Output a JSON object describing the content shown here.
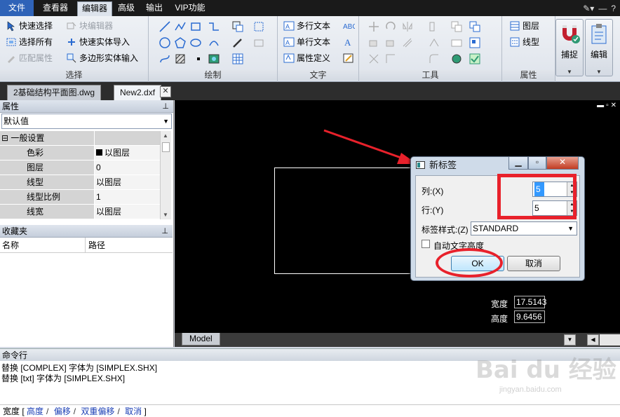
{
  "menu": {
    "tabs": [
      "文件",
      "查看器",
      "编辑器",
      "高级",
      "输出",
      "VIP功能"
    ],
    "active_tab": "编辑器"
  },
  "ribbon": {
    "select_group": {
      "label": "选择",
      "buttons": [
        "快速选择",
        "选择所有",
        "匹配属性",
        "块编辑器",
        "快速实体导入",
        "多边形实体输入"
      ]
    },
    "draw_group": {
      "label": "绘制"
    },
    "text_group": {
      "label": "文字",
      "buttons": [
        "多行文本",
        "单行文本",
        "属性定义"
      ]
    },
    "tools_group": {
      "label": "工具"
    },
    "props_group": {
      "label": "属性",
      "buttons": [
        "图层",
        "线型"
      ]
    },
    "snap_label": "捕捉",
    "edit_label": "编辑"
  },
  "doc_tabs": [
    "2基础结构平面图.dwg",
    "New2.dxf"
  ],
  "properties_panel": {
    "title": "属性",
    "dropdown": "默认值",
    "section": "一般设置",
    "rows": [
      {
        "key": "色彩",
        "value": "以图层"
      },
      {
        "key": "图层",
        "value": "0"
      },
      {
        "key": "线型",
        "value": "以图层"
      },
      {
        "key": "线型比例",
        "value": "1"
      },
      {
        "key": "线宽",
        "value": "以图层"
      }
    ]
  },
  "favorites_panel": {
    "title": "收藏夹",
    "columns": [
      "名称",
      "路径"
    ]
  },
  "canvas": {
    "width_label": "宽度",
    "width_value": "17.5143",
    "height_label": "高度",
    "height_value": "9.6456",
    "model_tab": "Model"
  },
  "dialog": {
    "title": "新标签",
    "columns_label": "列:(X)",
    "columns_value": "5",
    "rows_label": "行:(Y)",
    "rows_value": "5",
    "style_label": "标签样式:(Z)",
    "style_value": "STANDARD",
    "auto_text_label": "自动文字高度",
    "ok_label": "OK",
    "cancel_label": "取消"
  },
  "command": {
    "title": "命令行",
    "log": [
      "替换 [COMPLEX] 字体为 [SIMPLEX.SHX]",
      "替换 [txt] 字体为 [SIMPLEX.SHX]"
    ],
    "prompt_prefix": "宽度 [",
    "options": [
      "高度",
      "偏移",
      "双重偏移",
      "取消"
    ],
    "prompt_suffix": "]"
  },
  "watermark": {
    "brand": "Bai du 经验",
    "url": "jingyan.baidu.com"
  },
  "colors": {
    "accent_red": "#e8212b",
    "file_tab_blue": "#2f63b8",
    "canvas_bg": "#000000"
  }
}
